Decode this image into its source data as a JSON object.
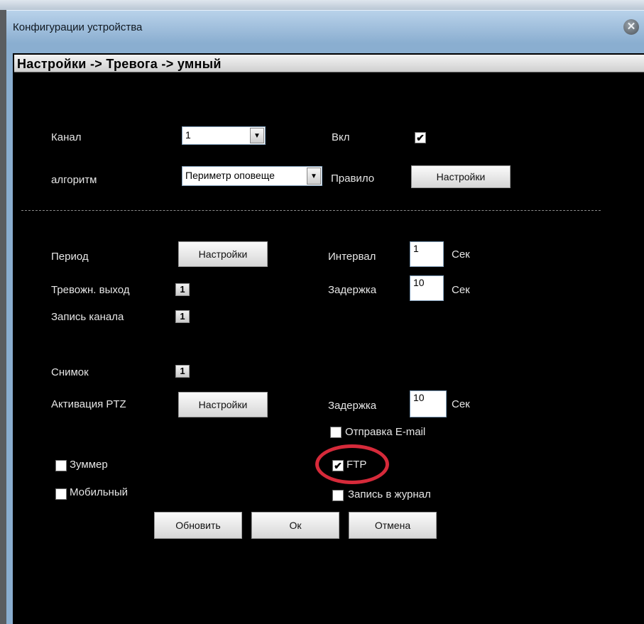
{
  "window": {
    "title": "Конфигурации устройства",
    "close_icon": "close-icon"
  },
  "breadcrumb": "Настройки -> Тревога -> умный",
  "channel": {
    "label": "Канал",
    "value": "1"
  },
  "enable": {
    "label": "Вкл",
    "checked": true
  },
  "algorithm": {
    "label": "алгоритм",
    "value": "Периметр оповеще"
  },
  "rule": {
    "label": "Правило",
    "button": "Настройки"
  },
  "period": {
    "label": "Период",
    "button": "Настройки"
  },
  "interval": {
    "label": "Интервал",
    "value": "1",
    "unit": "Сек"
  },
  "alarm_output": {
    "label": "Тревожн. выход",
    "value": "1"
  },
  "delay1": {
    "label": "Задержка",
    "value": "10",
    "unit": "Сек"
  },
  "record_channel": {
    "label": "Запись канала",
    "value": "1"
  },
  "snapshot": {
    "label": "Снимок",
    "value": "1"
  },
  "ptz": {
    "label": "Активация PTZ",
    "button": "Настройки"
  },
  "delay2": {
    "label": "Задержка",
    "value": "10",
    "unit": "Сек"
  },
  "options": {
    "email": {
      "label": "Отправка E-mail",
      "checked": false
    },
    "buzzer": {
      "label": "Зуммер",
      "checked": false
    },
    "ftp": {
      "label": "FTP",
      "checked": true
    },
    "mobile": {
      "label": "Мобильный",
      "checked": false
    },
    "log": {
      "label": "Запись в журнал",
      "checked": false
    }
  },
  "footer": {
    "refresh": "Обновить",
    "ok": "Ок",
    "cancel": "Отмена"
  },
  "colors": {
    "highlight": "#d62a3a",
    "titlebar": "#8aaed0"
  }
}
